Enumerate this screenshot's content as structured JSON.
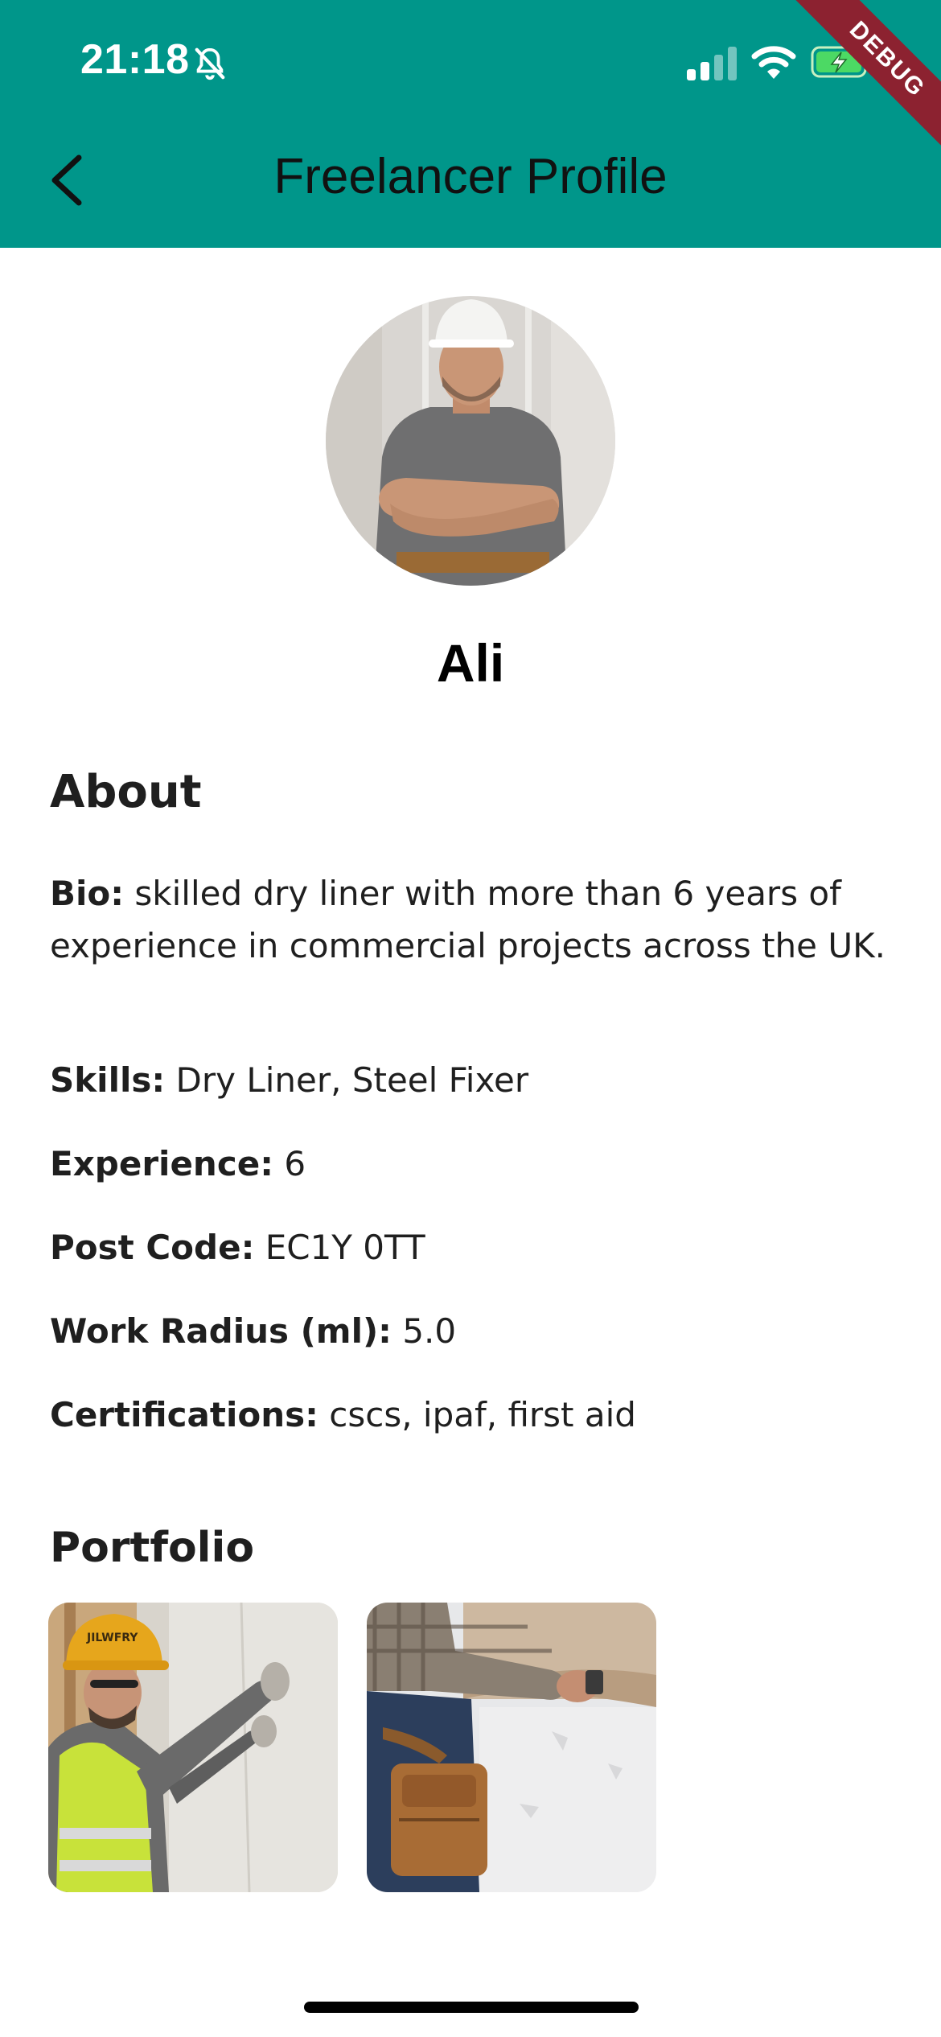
{
  "status_bar": {
    "time": "21:18",
    "icons": [
      "bell-slash-icon",
      "cellular-signal-icon",
      "wifi-icon",
      "battery-charging-icon"
    ],
    "debug_banner": "DEBUG"
  },
  "app_bar": {
    "title": "Freelancer Profile",
    "back_icon": "chevron-left-icon",
    "background_color": "#00968a"
  },
  "profile": {
    "name": "Ali",
    "avatar_description": "man-in-white-hard-hat-arms-crossed"
  },
  "about": {
    "heading": "About",
    "bio_label": "Bio:",
    "bio_value": "skilled dry liner with more than 6 years of experience in commercial projects across the UK.",
    "skills_label": "Skills:",
    "skills_value": "Dry Liner, Steel Fixer",
    "experience_label": "Experience:",
    "experience_value": "6",
    "postcode_label": "Post Code:",
    "postcode_value": "EC1Y 0TT",
    "radius_label": "Work Radius (ml):",
    "radius_value": "5.0",
    "certifications_label": "Certifications:",
    "certifications_value": "cscs, ipaf, first aid"
  },
  "portfolio": {
    "heading": "Portfolio",
    "items": [
      {
        "image": "worker-in-yellow-helmet-drylining",
        "helmet_text": "JILWFRY"
      },
      {
        "image": "worker-with-tool-belt-plastering"
      }
    ]
  }
}
